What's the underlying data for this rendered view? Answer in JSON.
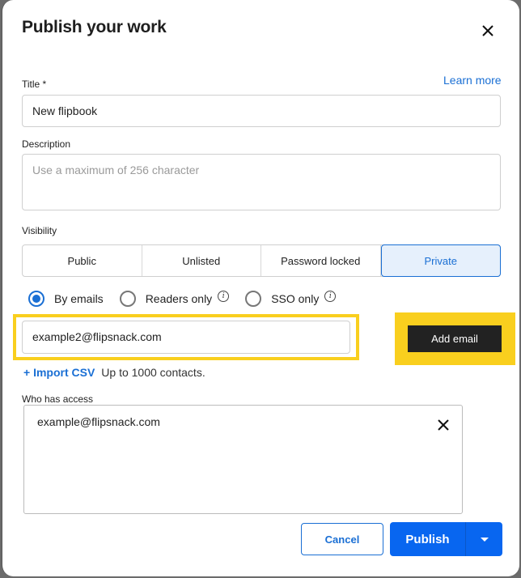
{
  "dialog": {
    "title": "Publish your work",
    "learn_more": "Learn more"
  },
  "title_field": {
    "label": "Title *",
    "value": "New flipbook"
  },
  "description_field": {
    "label": "Description",
    "placeholder": "Use a maximum of 256 character",
    "value": ""
  },
  "visibility": {
    "label": "Visibility",
    "options": [
      {
        "label": "Public",
        "selected": false
      },
      {
        "label": "Unlisted",
        "selected": false
      },
      {
        "label": "Password locked",
        "selected": false
      },
      {
        "label": "Private",
        "selected": true
      }
    ]
  },
  "private_mode": {
    "options": [
      {
        "label": "By emails",
        "checked": true,
        "info": false
      },
      {
        "label": "Readers only",
        "checked": false,
        "info": true
      },
      {
        "label": "SSO only",
        "checked": false,
        "info": true
      }
    ],
    "info_glyph": "i"
  },
  "email_entry": {
    "value": "example2@flipsnack.com",
    "add_button": "Add email",
    "highlight_color": "#f9cf1e"
  },
  "import": {
    "link": "+ Import CSV",
    "note": "Up to 1000 contacts."
  },
  "access": {
    "label": "Who has access",
    "emails": [
      "example@flipsnack.com"
    ]
  },
  "footer": {
    "cancel": "Cancel",
    "publish": "Publish"
  },
  "colors": {
    "accent": "#1a6fd4",
    "primary_button": "#0866f0",
    "dark_button": "#222222"
  }
}
